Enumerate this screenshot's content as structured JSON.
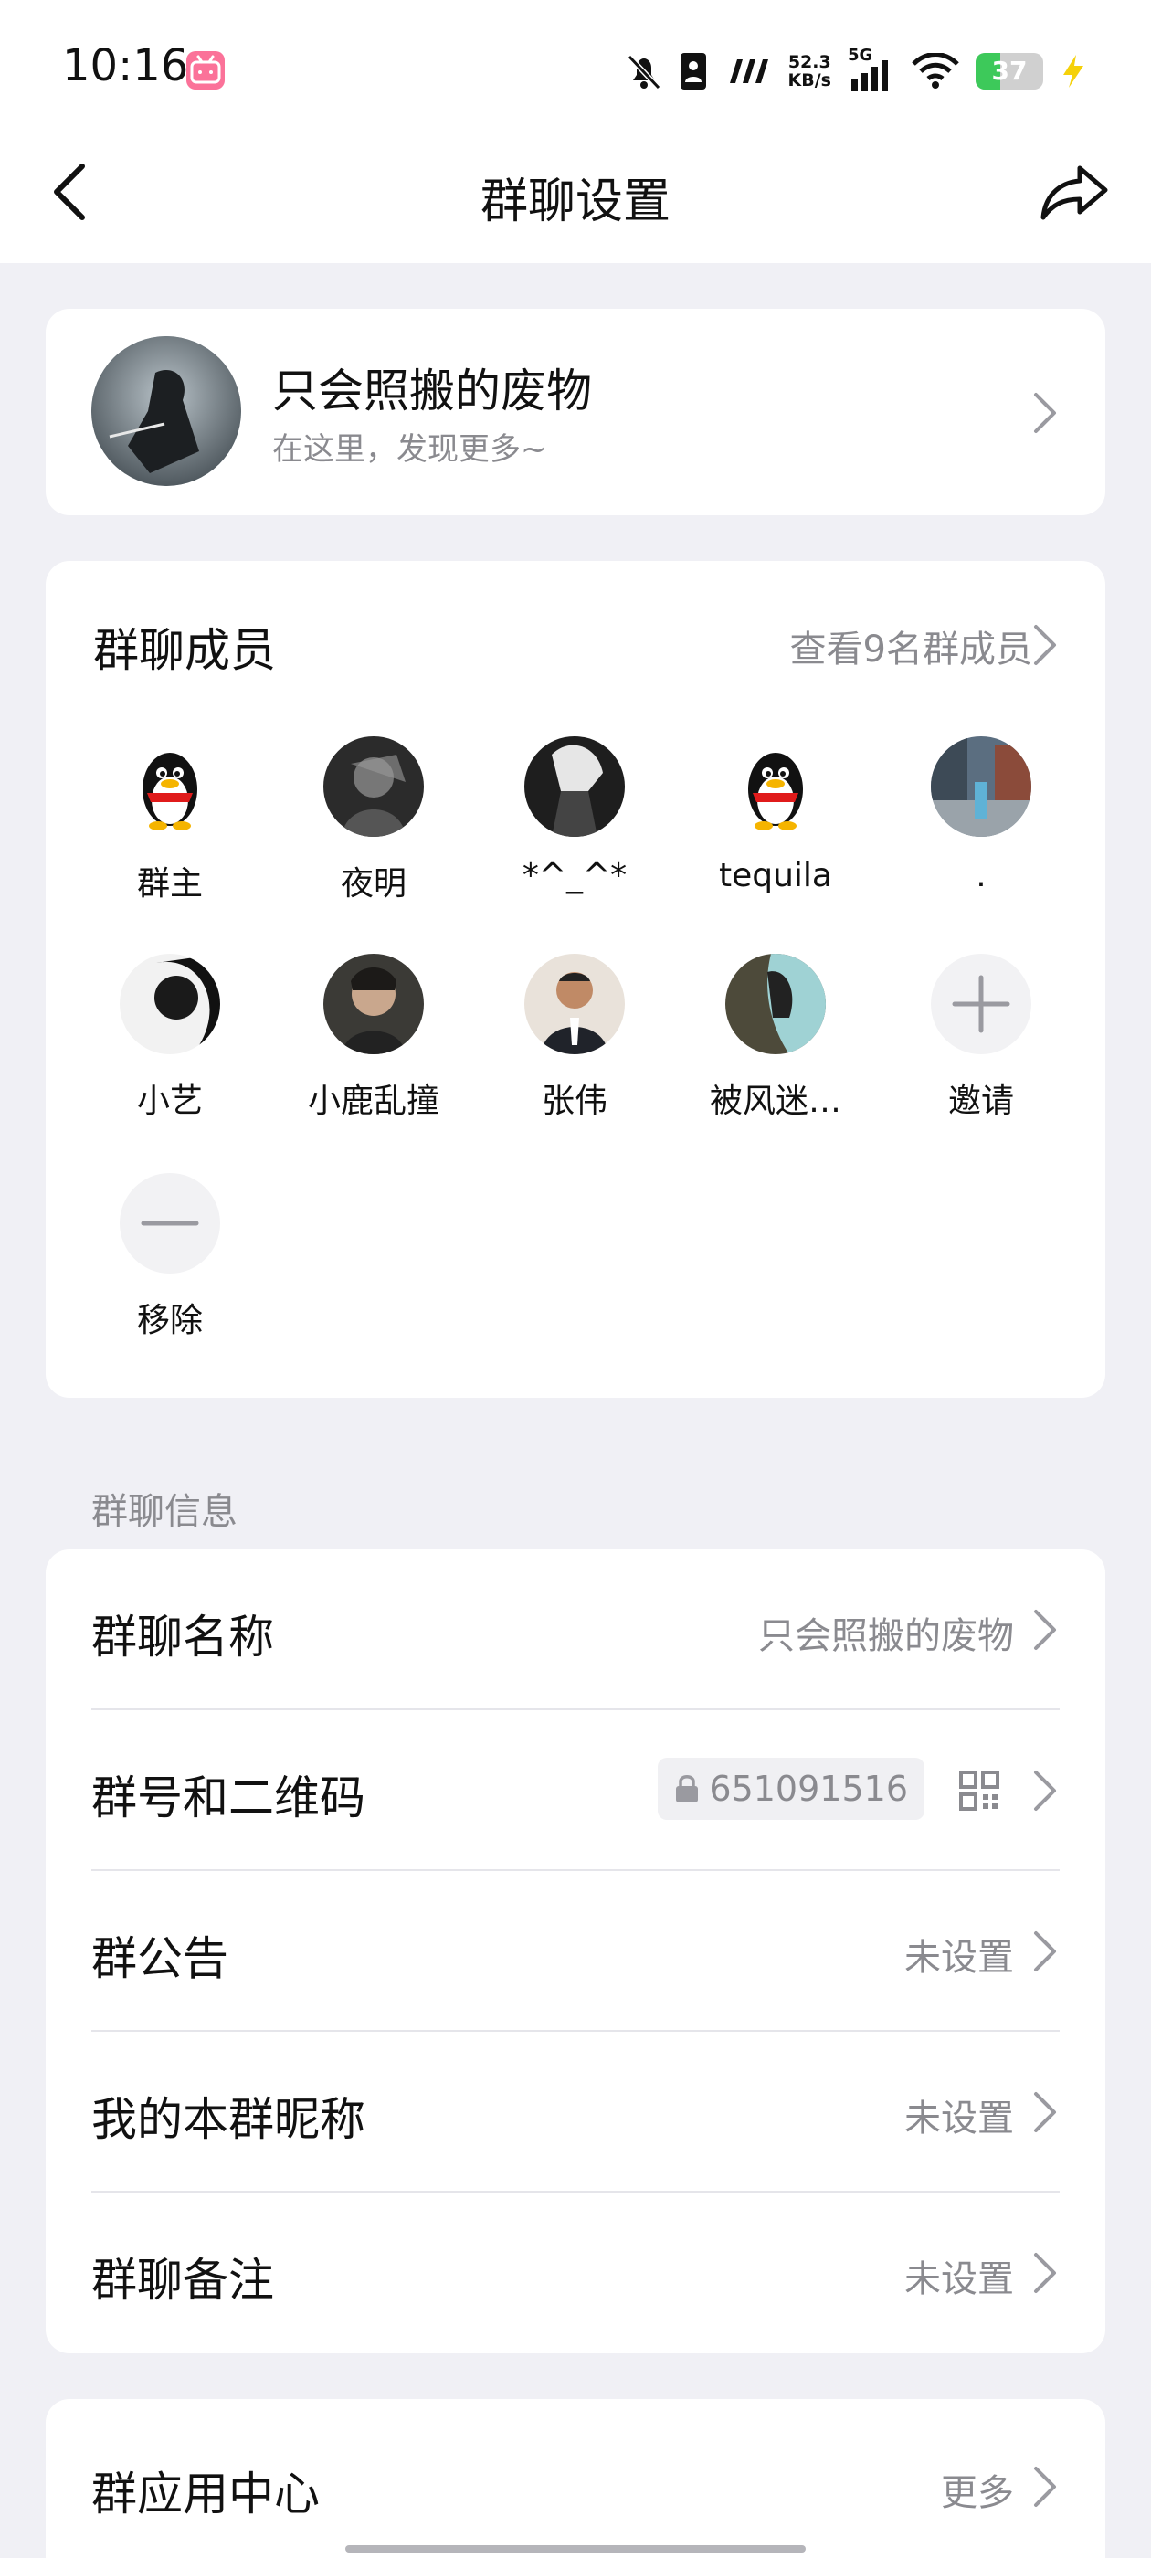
{
  "status_bar": {
    "time": "10:16",
    "app_badge": "bilibili",
    "net_speed_value": "52.3",
    "net_speed_unit": "KB/s",
    "network": "5G",
    "battery": "37",
    "battery_level": 0.37
  },
  "header": {
    "title": "群聊设置"
  },
  "profile": {
    "name": "只会照搬的废物",
    "subtitle": "在这里，发现更多~"
  },
  "members": {
    "title": "群聊成员",
    "view_all": "查看9名群成员",
    "items": [
      {
        "name": "群主",
        "avatar": "qq-penguin"
      },
      {
        "name": "夜明",
        "avatar": "photo-dark"
      },
      {
        "name": "*^_^*",
        "avatar": "photo-anime"
      },
      {
        "name": "tequila",
        "avatar": "qq-penguin"
      },
      {
        "name": ".",
        "avatar": "photo-street"
      },
      {
        "name": "小艺",
        "avatar": "photo-bw"
      },
      {
        "name": "小鹿乱撞",
        "avatar": "photo-person"
      },
      {
        "name": "张伟",
        "avatar": "photo-man"
      },
      {
        "name": "被风迷…",
        "avatar": "photo-art"
      }
    ],
    "invite_label": "邀请",
    "remove_label": "移除"
  },
  "info": {
    "section_label": "群聊信息",
    "rows": [
      {
        "label": "群聊名称",
        "value": "只会照搬的废物"
      },
      {
        "label": "群号和二维码",
        "value": "651091516"
      },
      {
        "label": "群公告",
        "value": "未设置"
      },
      {
        "label": "我的本群昵称",
        "value": "未设置"
      },
      {
        "label": "群聊备注",
        "value": "未设置"
      }
    ]
  },
  "apps": {
    "label": "群应用中心",
    "value": "更多"
  },
  "colors": {
    "background": "#f0f0f5",
    "card": "#ffffff",
    "secondary_text": "#8a8a8f",
    "battery_green": "#3dc95a",
    "bili_pink": "#fb7299"
  }
}
